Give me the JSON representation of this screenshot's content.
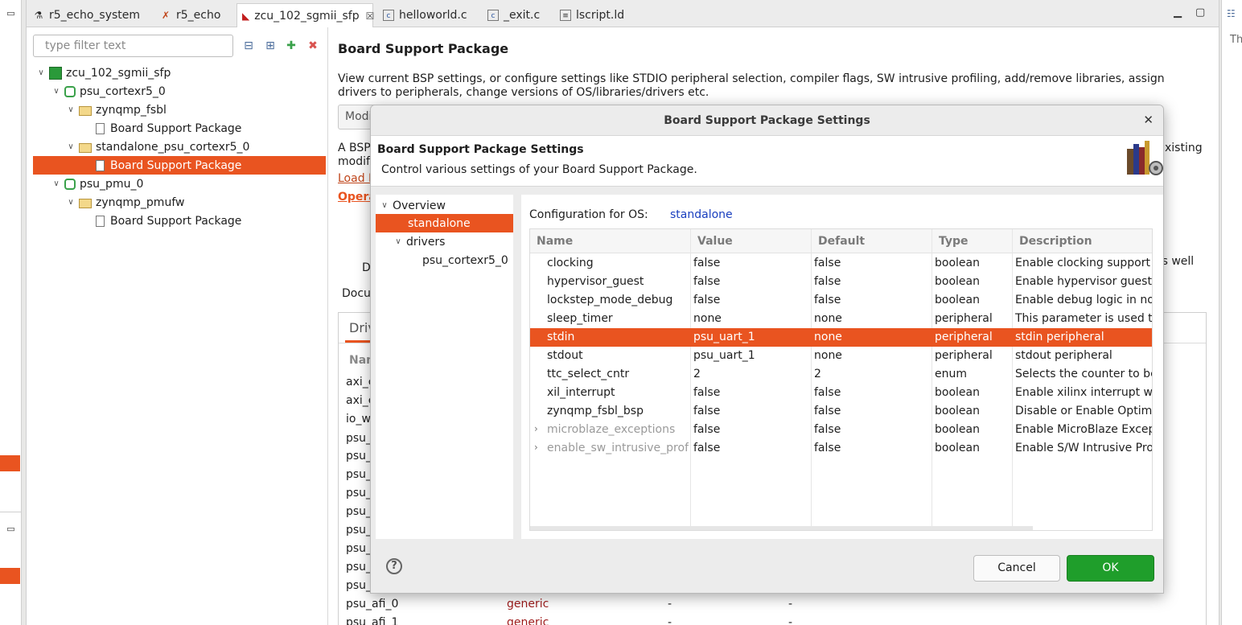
{
  "tabs": [
    {
      "label": "r5_echo_system",
      "icon": "system-project-icon"
    },
    {
      "label": "r5_echo",
      "icon": "app-project-icon"
    },
    {
      "label": "zcu_102_sgmii_sfp",
      "icon": "platform-icon",
      "active": true
    },
    {
      "label": "helloworld.c",
      "icon": "c-file-icon"
    },
    {
      "label": "_exit.c",
      "icon": "c-file-icon"
    },
    {
      "label": "lscript.ld",
      "icon": "linker-script-icon"
    }
  ],
  "filter": {
    "placeholder": "type filter text"
  },
  "tree": {
    "root": "zcu_102_sgmii_sfp",
    "cpu1": "psu_cortexr5_0",
    "fsbl": "zynqmp_fsbl",
    "bsp1": "Board Support Package",
    "standalone": "standalone_psu_cortexr5_0",
    "bsp2": "Board Support Package",
    "cpu2": "psu_pmu_0",
    "pmufw": "zynqmp_pmufw",
    "bsp3": "Board Support Package"
  },
  "page": {
    "title": "Board Support Package",
    "description": "View current BSP settings, or configure settings like STDIO peripheral selection, compiler flags, SW intrusive profiling, add/remove libraries, assign drivers to peripherals, change versions of OS/libraries/drivers etc.",
    "modify_button_partial": "Modi",
    "text_a_bsp": "A BSP",
    "text_modif": "modif",
    "text_existing": "xisting",
    "link_load": "Load B",
    "link_opera": "Opera",
    "text_d": "D",
    "text_as_well": "as well",
    "text_docu": "Docu",
    "tab_driv": "Driv",
    "col_nam": "Nam",
    "driver_rows": [
      "axi_c",
      "axi_e",
      "io_w",
      "psu_",
      "psu_",
      "psu_",
      "psu_",
      "psu_",
      "psu_",
      "psu_",
      "psu_",
      "psu_",
      "psu_afi_0",
      "psu_afi_1"
    ],
    "generic_label": "generic",
    "dash": "-"
  },
  "dialog": {
    "window_title": "Board Support Package Settings",
    "header_title": "Board Support Package Settings",
    "header_subtitle": "Control various settings of your Board Support Package.",
    "nav": {
      "overview": "Overview",
      "standalone": "standalone",
      "drivers": "drivers",
      "driver_item": "psu_cortexr5_0"
    },
    "config_label": "Configuration for OS:",
    "config_os": "standalone",
    "columns": [
      "Name",
      "Value",
      "Default",
      "Type",
      "Description"
    ],
    "rows": [
      {
        "name": "clocking",
        "value": "false",
        "default": "false",
        "type": "boolean",
        "description": "Enable clocking support"
      },
      {
        "name": "hypervisor_guest",
        "value": "false",
        "default": "false",
        "type": "boolean",
        "description": "Enable hypervisor guest su"
      },
      {
        "name": "lockstep_mode_debug",
        "value": "false",
        "default": "false",
        "type": "boolean",
        "description": "Enable debug logic in non-"
      },
      {
        "name": "sleep_timer",
        "value": "none",
        "default": "none",
        "type": "peripheral",
        "description": "This parameter is used to"
      },
      {
        "name": "stdin",
        "value": "psu_uart_1",
        "default": "none",
        "type": "peripheral",
        "description": "stdin peripheral",
        "selected": true
      },
      {
        "name": "stdout",
        "value": "psu_uart_1",
        "default": "none",
        "type": "peripheral",
        "description": "stdout peripheral"
      },
      {
        "name": "ttc_select_cntr",
        "value": "2",
        "default": "2",
        "type": "enum",
        "description": "Selects the counter to be u"
      },
      {
        "name": "xil_interrupt",
        "value": "false",
        "default": "false",
        "type": "boolean",
        "description": "Enable xilinx interrupt wra"
      },
      {
        "name": "zynqmp_fsbl_bsp",
        "value": "false",
        "default": "false",
        "type": "boolean",
        "description": "Disable or Enable Optimiz"
      },
      {
        "name": "microblaze_exceptions",
        "value": "false",
        "default": "false",
        "type": "boolean",
        "description": "Enable MicroBlaze Except",
        "expandable": true
      },
      {
        "name": "enable_sw_intrusive_profi",
        "value": "false",
        "default": "false",
        "type": "boolean",
        "description": "Enable S/W Intrusive Prof",
        "expandable": true
      }
    ],
    "help_symbol": "?",
    "cancel_label": "Cancel",
    "ok_label": "OK"
  },
  "right_strip_text": "Th",
  "colors": {
    "selection": "#e95420",
    "ok_button": "#1f9e2b",
    "os_link": "#1a3fbf"
  }
}
